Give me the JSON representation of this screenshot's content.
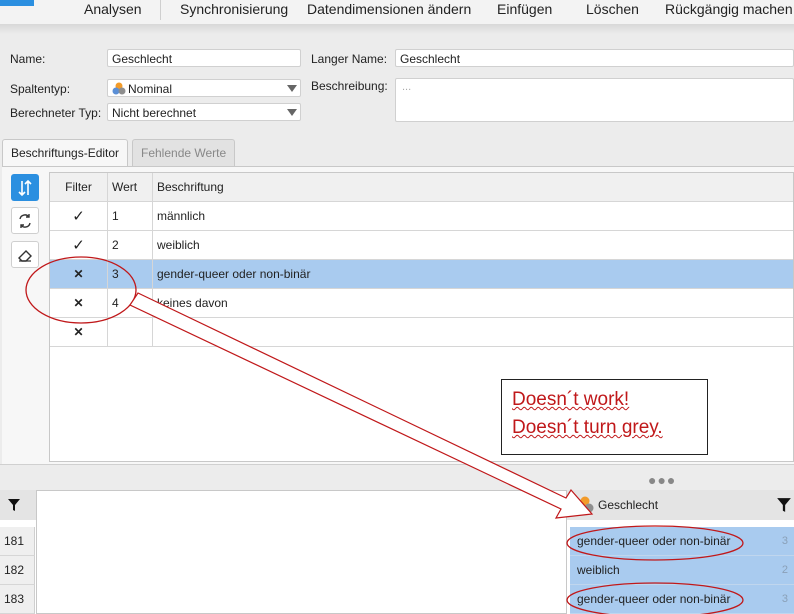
{
  "menu": {
    "items": [
      "Analysen",
      "Synchronisierung",
      "Datendimensionen ändern",
      "Einfügen",
      "Löschen",
      "Rückgängig machen"
    ]
  },
  "properties": {
    "name_label": "Name:",
    "name_value": "Geschlecht",
    "long_name_label": "Langer Name:",
    "long_name_value": "Geschlecht",
    "column_type_label": "Spaltentyp:",
    "column_type_value": "Nominal",
    "description_label": "Beschreibung:",
    "description_placeholder": "...",
    "computed_type_label": "Berechneter Typ:",
    "computed_type_value": "Nicht berechnet"
  },
  "tabs": {
    "label_editor": "Beschriftungs-Editor",
    "missing_values": "Fehlende Werte"
  },
  "labels_table": {
    "headers": [
      "Filter",
      "Wert",
      "Beschriftung"
    ],
    "rows": [
      {
        "filter": "✓",
        "value": "1",
        "label": "männlich"
      },
      {
        "filter": "✓",
        "value": "2",
        "label": "weiblich"
      },
      {
        "filter": "✕",
        "value": "3",
        "label": "gender-queer oder non-binär"
      },
      {
        "filter": "✕",
        "value": "4",
        "label": "keines davon"
      },
      {
        "filter": "✕",
        "value": "",
        "label": ""
      }
    ]
  },
  "data_grid": {
    "column_header": "Geschlecht",
    "rows": [
      {
        "num": "181",
        "value": "gender-queer oder non-binär",
        "code": "3"
      },
      {
        "num": "182",
        "value": "weiblich",
        "code": "2"
      },
      {
        "num": "183",
        "value": "gender-queer oder non-binär",
        "code": "3"
      }
    ]
  },
  "annotation": {
    "line1": "Doesn´t work!",
    "line2": "Doesn´t turn grey."
  },
  "colors": {
    "accent": "#2b8fe0",
    "selected_row": "#a9cbef",
    "annotation_red": "#c0181a"
  }
}
